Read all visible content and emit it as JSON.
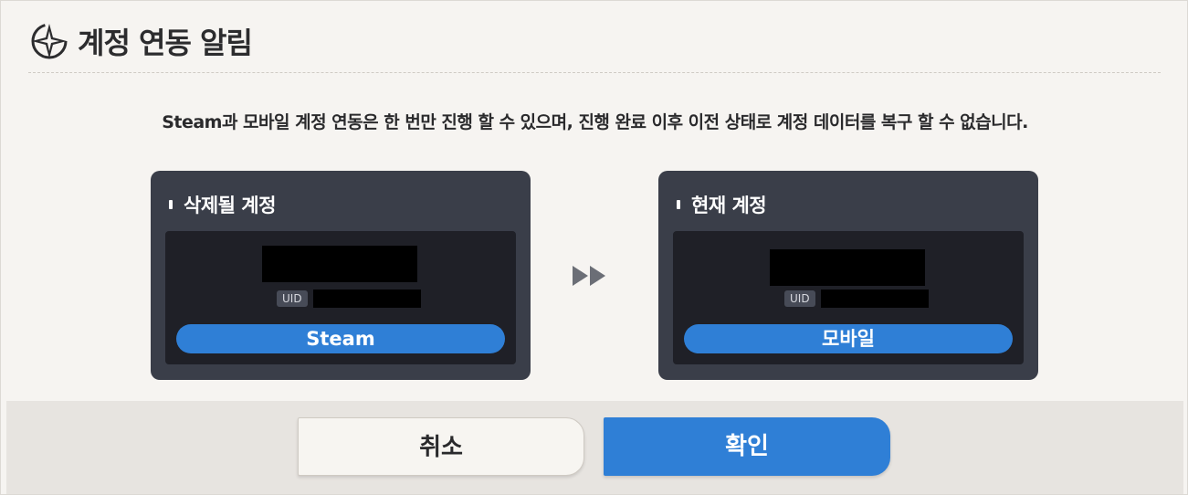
{
  "header": {
    "title": "계정 연동 알림",
    "icon": "compass-star-icon"
  },
  "notice": "Steam과 모바일 계정 연동은 한 번만 진행 할 수 있으며, 진행 완료 이후 이전 상태로 계정 데이터를 복구 할 수 없습니다.",
  "cards": [
    {
      "title": "삭제될 계정",
      "uid_label": "UID",
      "platform": "Steam"
    },
    {
      "title": "현재 계정",
      "uid_label": "UID",
      "platform": "모바일"
    }
  ],
  "transfer_icon": "double-arrow-right-icon",
  "buttons": {
    "cancel": "취소",
    "confirm": "확인"
  },
  "colors": {
    "accent": "#2f7fd6",
    "card_bg": "#3a3e49",
    "card_inner_bg": "#1f2027"
  }
}
